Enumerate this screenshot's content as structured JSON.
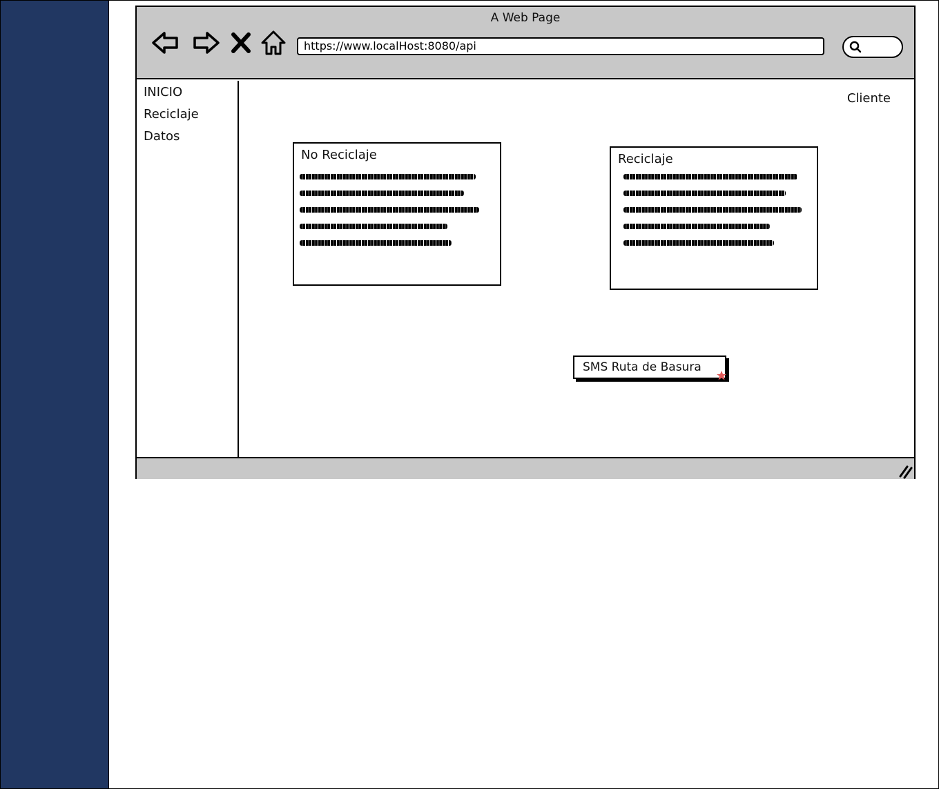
{
  "browser": {
    "title": "A Web Page",
    "url": "https://www.localHost:8080/api"
  },
  "sidebar": {
    "items": [
      {
        "label": "INICIO"
      },
      {
        "label": "Reciclaje"
      },
      {
        "label": "Datos"
      }
    ]
  },
  "header": {
    "user_label": "Cliente"
  },
  "cards": [
    {
      "title": "No Reciclaje"
    },
    {
      "title": "Reciclaje"
    }
  ],
  "actions": {
    "sms_button_label": "SMS Ruta de Basura"
  },
  "colors": {
    "side_band": "#213762",
    "chrome": "#c8c8c8",
    "accent_star": "#e05a5a"
  },
  "icons": [
    "back-arrow-icon",
    "forward-arrow-icon",
    "stop-icon",
    "home-icon",
    "search-icon",
    "resize-grip-icon",
    "star-icon"
  ]
}
